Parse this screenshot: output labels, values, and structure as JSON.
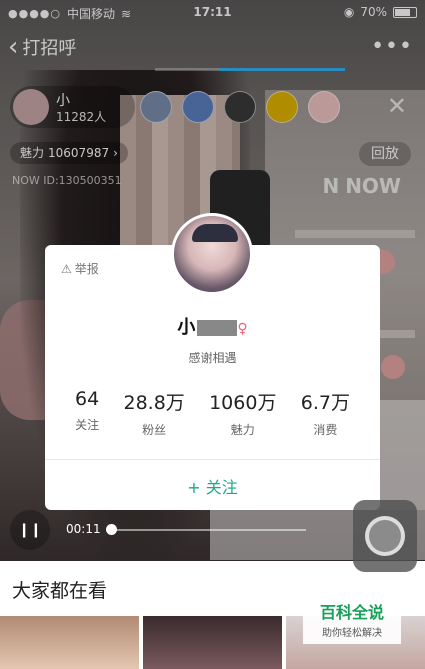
{
  "status_bar": {
    "carrier": "中国移动",
    "time": "17:11",
    "battery": "70%"
  },
  "nav": {
    "back_label": "打招呼"
  },
  "host": {
    "name": "小",
    "followers": "11282人"
  },
  "charm": {
    "label": "魅力",
    "value": "10607987"
  },
  "replay_label": "回放",
  "now_id": "NOW ID:130500351",
  "brand": "NOW",
  "profile": {
    "report_label": "举报",
    "name": "小",
    "signature": "感谢相遇",
    "stats": [
      {
        "value": "64",
        "label": "关注"
      },
      {
        "value": "28.8万",
        "label": "粉丝"
      },
      {
        "value": "1060万",
        "label": "魅力"
      },
      {
        "value": "6.7万",
        "label": "消费"
      }
    ],
    "follow_label": "+ 关注"
  },
  "playback": {
    "current_time": "00:11"
  },
  "section_title": "大家都在看",
  "watermark": {
    "title": "百科全说",
    "subtitle": "助你轻松解决"
  },
  "colors": {
    "accent_green": "#1aaa89",
    "progress_blue": "#33b5f5",
    "female": "#f0657a"
  }
}
